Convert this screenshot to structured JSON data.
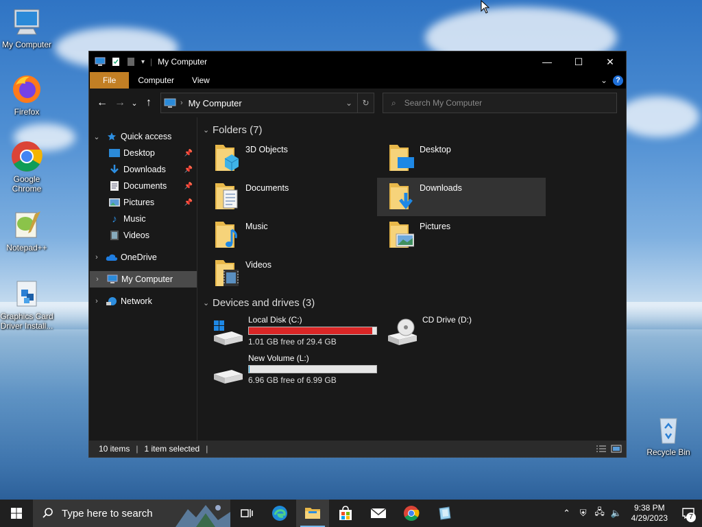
{
  "desktop": {
    "icons": [
      {
        "label": "My Computer"
      },
      {
        "label": "Firefox"
      },
      {
        "label": "Google Chrome"
      },
      {
        "label": "Notepad++"
      },
      {
        "label": "Graphics Card Driver Install..."
      },
      {
        "label": "Recycle Bin"
      }
    ]
  },
  "window": {
    "title": "My Computer",
    "ribbon_tabs": [
      "File",
      "Computer",
      "View"
    ],
    "address": {
      "crumb": "My Computer"
    },
    "search": {
      "placeholder": "Search My Computer"
    },
    "nav": [
      {
        "label": "Quick access",
        "icon": "star-icon"
      },
      {
        "label": "Desktop",
        "icon": "desktop-icon",
        "pinned": true
      },
      {
        "label": "Downloads",
        "icon": "download-arrow-icon",
        "pinned": true
      },
      {
        "label": "Documents",
        "icon": "document-icon",
        "pinned": true
      },
      {
        "label": "Pictures",
        "icon": "pictures-icon",
        "pinned": true
      },
      {
        "label": "Music",
        "icon": "music-note-icon"
      },
      {
        "label": "Videos",
        "icon": "video-icon"
      },
      {
        "label": "OneDrive",
        "icon": "cloud-icon"
      },
      {
        "label": "My Computer",
        "icon": "computer-icon",
        "selected": true
      },
      {
        "label": "Network",
        "icon": "network-icon"
      }
    ],
    "folders_header": "Folders (7)",
    "folders": [
      {
        "name": "3D Objects"
      },
      {
        "name": "Desktop"
      },
      {
        "name": "Documents"
      },
      {
        "name": "Downloads",
        "selected": true
      },
      {
        "name": "Music"
      },
      {
        "name": "Pictures"
      },
      {
        "name": "Videos"
      }
    ],
    "drives_header": "Devices and drives (3)",
    "drives": [
      {
        "name": "Local Disk (C:)",
        "free": "1.01 GB free of 29.4 GB",
        "used_fraction": 0.966,
        "bar_color": "#da2626"
      },
      {
        "name": "CD Drive (D:)"
      },
      {
        "name": "New Volume (L:)",
        "free": "6.96 GB free of 6.99 GB",
        "used_fraction": 0.004,
        "bar_color": "#26a0da"
      }
    ],
    "status": {
      "items": "10 items",
      "selected": "1 item selected"
    }
  },
  "taskbar": {
    "search_placeholder": "Type here to search",
    "apps": [
      "task-view-icon",
      "edge-icon",
      "file-explorer-icon",
      "store-icon",
      "mail-icon",
      "chrome-icon",
      "driver-installer-icon"
    ],
    "clock": {
      "time": "9:38 PM",
      "date": "4/29/2023"
    },
    "notifications": "7"
  }
}
